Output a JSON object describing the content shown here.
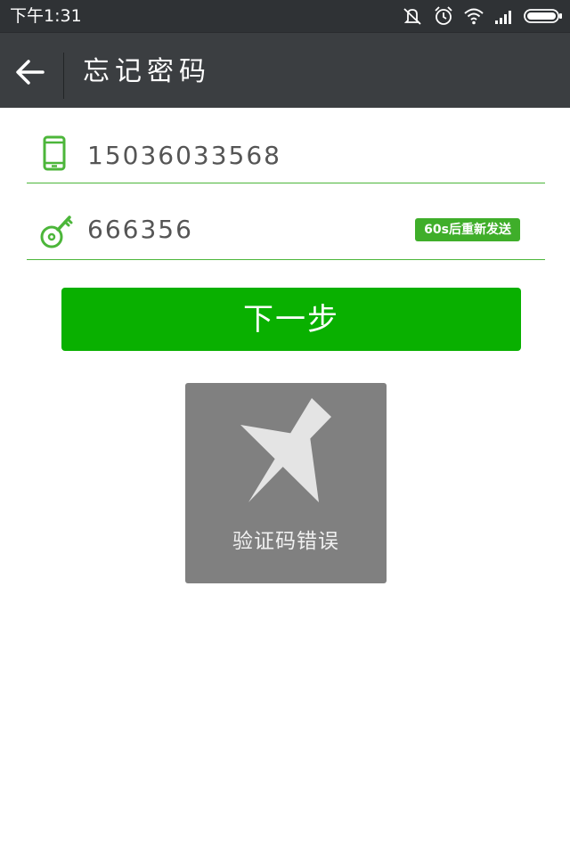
{
  "status_bar": {
    "time": "下午1:31",
    "icons": [
      "mute-icon",
      "alarm-icon",
      "wifi-icon",
      "signal-icon",
      "battery-icon"
    ]
  },
  "header": {
    "back_icon": "arrow-left-icon",
    "title": "忘记密码"
  },
  "form": {
    "phone": {
      "icon": "mobile-phone-icon",
      "value": "15036033568"
    },
    "code": {
      "icon": "key-icon",
      "value": "666356",
      "resend_label": "60s后重新发送"
    }
  },
  "next_button_label": "下一步",
  "toast": {
    "icon": "cross-icon",
    "message": "验证码错误"
  },
  "colors": {
    "status_bar_bg": "#2f3235",
    "title_bar_bg": "#3b3e41",
    "accent_green": "#09b000",
    "line_green": "#4cb63a",
    "badge_green": "#3fae2a",
    "toast_bg": "#808080"
  }
}
